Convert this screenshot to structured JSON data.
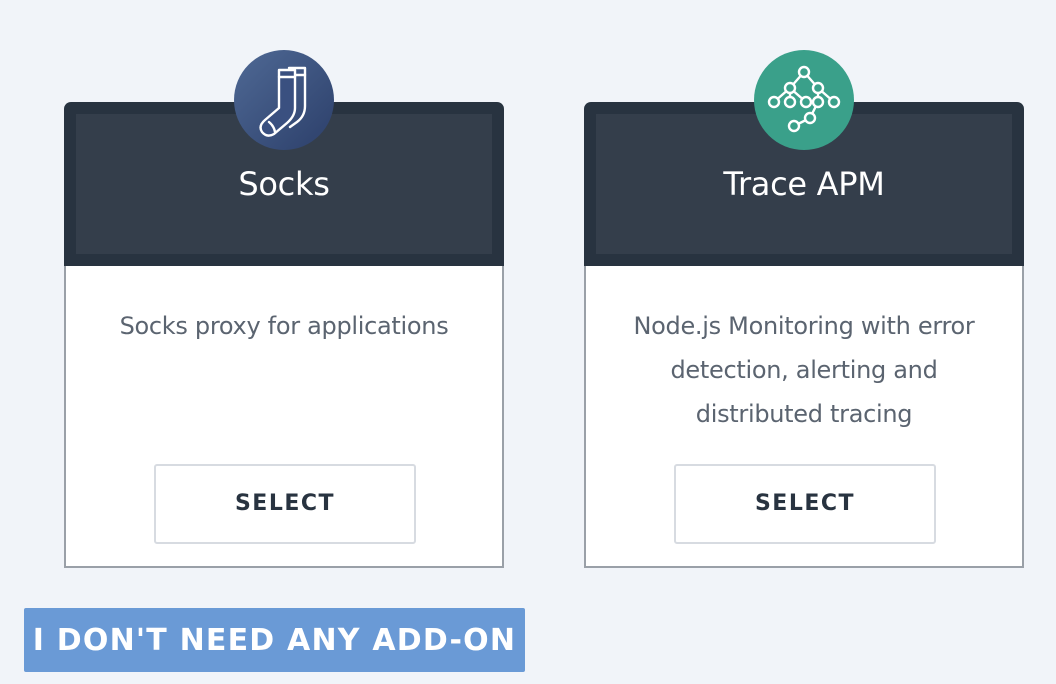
{
  "cards": [
    {
      "title": "Socks",
      "description": "Socks proxy for applications",
      "button_label": "SELECT",
      "icon": "socks-icon"
    },
    {
      "title": "Trace APM",
      "description": "Node.js Monitoring with error detection, alerting and distributed tracing",
      "button_label": "SELECT",
      "icon": "network-tree-icon"
    }
  ],
  "skip_button_label": "I DON'T NEED ANY ADD-ON",
  "colors": {
    "background": "#f1f4f9",
    "card_header": "#343e4b",
    "card_header_border": "#283340",
    "socks_icon_bg": "#3d5581",
    "trace_icon_bg": "#3aa08a",
    "skip_button_bg": "#6a9ad6",
    "description_text": "#5b6470"
  }
}
